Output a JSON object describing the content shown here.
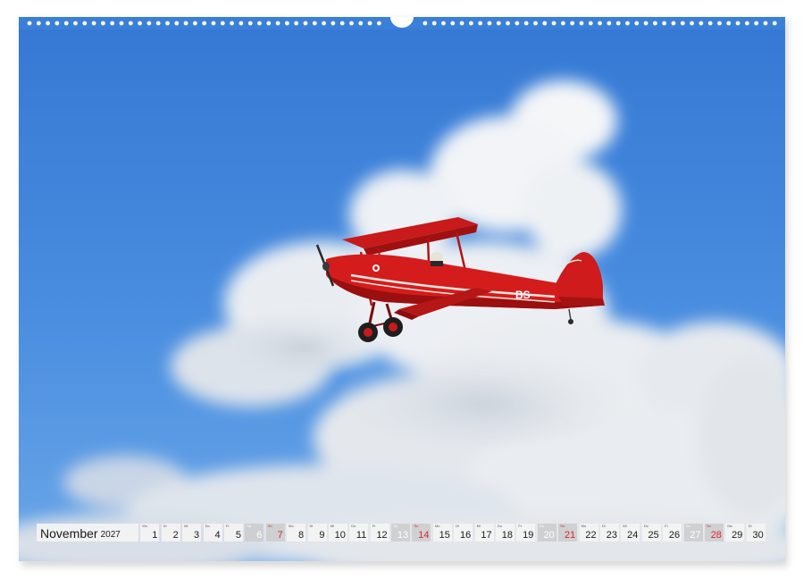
{
  "calendar": {
    "month": "November",
    "year": "2027",
    "days": [
      {
        "wd": "Mo",
        "num": "1",
        "type": "weekday"
      },
      {
        "wd": "Di",
        "num": "2",
        "type": "weekday"
      },
      {
        "wd": "Mi",
        "num": "3",
        "type": "weekday"
      },
      {
        "wd": "Do",
        "num": "4",
        "type": "weekday"
      },
      {
        "wd": "Fr",
        "num": "5",
        "type": "weekday"
      },
      {
        "wd": "Sa",
        "num": "6",
        "type": "sat"
      },
      {
        "wd": "So",
        "num": "7",
        "type": "sun"
      },
      {
        "wd": "Mo",
        "num": "8",
        "type": "weekday"
      },
      {
        "wd": "Di",
        "num": "9",
        "type": "weekday"
      },
      {
        "wd": "Mi",
        "num": "10",
        "type": "weekday"
      },
      {
        "wd": "Do",
        "num": "11",
        "type": "weekday"
      },
      {
        "wd": "Fr",
        "num": "12",
        "type": "weekday"
      },
      {
        "wd": "Sa",
        "num": "13",
        "type": "sat"
      },
      {
        "wd": "So",
        "num": "14",
        "type": "sun"
      },
      {
        "wd": "Mo",
        "num": "15",
        "type": "weekday"
      },
      {
        "wd": "Di",
        "num": "16",
        "type": "weekday"
      },
      {
        "wd": "Mi",
        "num": "17",
        "type": "weekday"
      },
      {
        "wd": "Do",
        "num": "18",
        "type": "weekday"
      },
      {
        "wd": "Fr",
        "num": "19",
        "type": "weekday"
      },
      {
        "wd": "Sa",
        "num": "20",
        "type": "sat"
      },
      {
        "wd": "So",
        "num": "21",
        "type": "sun"
      },
      {
        "wd": "Mo",
        "num": "22",
        "type": "weekday"
      },
      {
        "wd": "Di",
        "num": "23",
        "type": "weekday"
      },
      {
        "wd": "Mi",
        "num": "24",
        "type": "weekday"
      },
      {
        "wd": "Do",
        "num": "25",
        "type": "weekday"
      },
      {
        "wd": "Fr",
        "num": "26",
        "type": "weekday"
      },
      {
        "wd": "Sa",
        "num": "27",
        "type": "sat"
      },
      {
        "wd": "So",
        "num": "28",
        "type": "sun"
      },
      {
        "wd": "Mo",
        "num": "29",
        "type": "weekday"
      },
      {
        "wd": "Di",
        "num": "30",
        "type": "weekday"
      }
    ]
  },
  "photo": {
    "plane_marking": "BS",
    "sky_color": "#3b82d9",
    "plane_color": "#cf1b1b"
  }
}
